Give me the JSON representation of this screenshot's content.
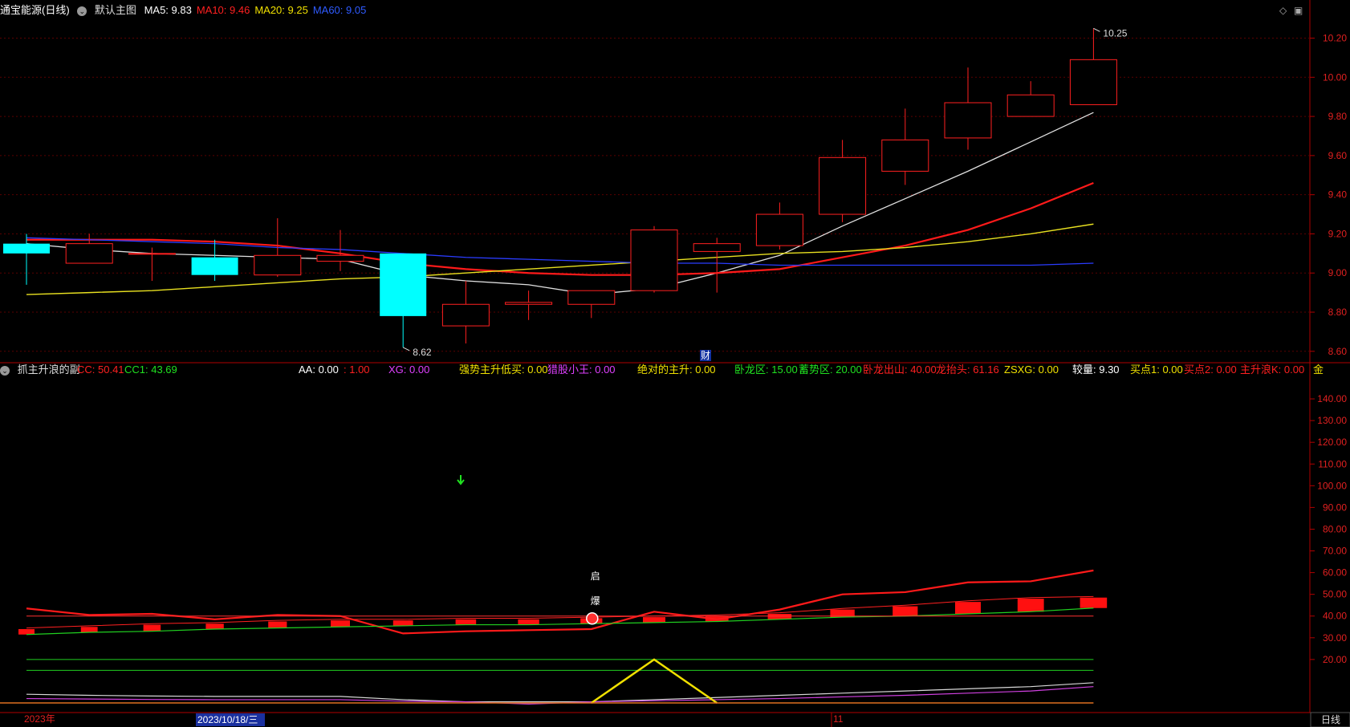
{
  "header": {
    "stock_title": "通宝能源(日线)",
    "template_name": "默认主图",
    "ma_items": [
      {
        "label": "MA5: 9.83",
        "color": "#ffffff"
      },
      {
        "label": "MA10: 9.46",
        "color": "#ff2020"
      },
      {
        "label": "MA20: 9.25",
        "color": "#f0e000"
      },
      {
        "label": "MA60: 9.05",
        "color": "#2f5bff"
      }
    ]
  },
  "indicator_header": {
    "name": "抓主升浪的副",
    "items": [
      {
        "label": "CC: 50.41",
        "color": "#ff2020"
      },
      {
        "label": "CC1: 43.69",
        "color": "#20e020"
      },
      {
        "label": "AA: 0.00",
        "color": "#ffffff"
      },
      {
        "label": ": 1.00",
        "color": "#ff2020"
      },
      {
        "label": "XG: 0.00",
        "color": "#e040ff"
      },
      {
        "label": "强势主升低买: 0.00",
        "color": "#f0e000"
      },
      {
        "label": "猎股小王: 0.00",
        "color": "#e040ff"
      },
      {
        "label": "绝对的主升: 0.00",
        "color": "#f0e000"
      },
      {
        "label": "卧龙区: 15.00",
        "color": "#20e020"
      },
      {
        "label": "蓄势区: 20.00",
        "color": "#20e020"
      },
      {
        "label": "卧龙出山: 40.00",
        "color": "#ff2020"
      },
      {
        "label": "龙抬头: 61.16",
        "color": "#ff2020"
      },
      {
        "label": "ZSXG: 0.00",
        "color": "#f0e000"
      },
      {
        "label": "较量: 9.30",
        "color": "#ffffff"
      },
      {
        "label": "买点1: 0.00",
        "color": "#f0e000"
      },
      {
        "label": "买点2: 0.00",
        "color": "#ff2020"
      },
      {
        "label": "主升浪K: 0.00",
        "color": "#ff2020"
      },
      {
        "label": "金",
        "color": "#f0e000"
      }
    ]
  },
  "markers": {
    "high_label": "10.25",
    "low_label": "8.62",
    "cai_label": "财",
    "qi_label": "启",
    "bao_label": "爆"
  },
  "time_axis": {
    "year_label": "2023年",
    "cursor_date": "2023/10/18/三",
    "month_label": "11",
    "period_label": "日线"
  },
  "colors": {
    "up": "#ff2020",
    "down": "#00ffff",
    "ma5": "#e0e0e0",
    "ma10": "#ff1a1a",
    "ma20": "#e8e020",
    "ma60": "#2a3cff",
    "axis": "#b00000",
    "grid": "#5a0000"
  },
  "chart_data": [
    {
      "type": "candlestick",
      "title": "通宝能源(日线)",
      "ylim": [
        8.55,
        10.28
      ],
      "y_ticks": [
        8.6,
        8.8,
        9.0,
        9.2,
        9.4,
        9.6,
        9.8,
        10.0,
        10.2
      ],
      "candles": [
        {
          "o": 9.15,
          "c": 9.1,
          "h": 9.2,
          "l": 8.94
        },
        {
          "o": 9.05,
          "c": 9.15,
          "h": 9.2,
          "l": 9.05
        },
        {
          "o": 9.1,
          "c": 9.1,
          "h": 9.13,
          "l": 8.96
        },
        {
          "o": 9.08,
          "c": 8.99,
          "h": 9.17,
          "l": 8.96
        },
        {
          "o": 8.99,
          "c": 9.09,
          "h": 9.28,
          "l": 8.98
        },
        {
          "o": 9.06,
          "c": 9.09,
          "h": 9.22,
          "l": 9.01
        },
        {
          "o": 9.1,
          "c": 8.78,
          "h": 9.1,
          "l": 8.62
        },
        {
          "o": 8.73,
          "c": 8.84,
          "h": 8.96,
          "l": 8.64
        },
        {
          "o": 8.84,
          "c": 8.85,
          "h": 8.91,
          "l": 8.76
        },
        {
          "o": 8.84,
          "c": 8.91,
          "h": 8.91,
          "l": 8.77
        },
        {
          "o": 8.91,
          "c": 9.22,
          "h": 9.24,
          "l": 8.9
        },
        {
          "o": 9.11,
          "c": 9.15,
          "h": 9.18,
          "l": 8.9
        },
        {
          "o": 9.14,
          "c": 9.3,
          "h": 9.36,
          "l": 9.12
        },
        {
          "o": 9.3,
          "c": 9.59,
          "h": 9.68,
          "l": 9.26
        },
        {
          "o": 9.52,
          "c": 9.68,
          "h": 9.84,
          "l": 9.45
        },
        {
          "o": 9.69,
          "c": 9.87,
          "h": 10.05,
          "l": 9.63
        },
        {
          "o": 9.8,
          "c": 9.91,
          "h": 9.98,
          "l": 9.8
        },
        {
          "o": 9.86,
          "c": 10.09,
          "h": 10.25,
          "l": 9.86
        }
      ],
      "series": [
        {
          "name": "MA5",
          "values": [
            9.15,
            9.12,
            9.1,
            9.09,
            9.08,
            9.07,
            8.99,
            8.96,
            8.94,
            8.89,
            8.92,
            9.0,
            9.09,
            9.24,
            9.38,
            9.52,
            9.67,
            9.82
          ]
        },
        {
          "name": "MA10",
          "values": [
            9.17,
            9.17,
            9.17,
            9.16,
            9.14,
            9.1,
            9.05,
            9.02,
            9.0,
            8.99,
            8.99,
            9.0,
            9.02,
            9.08,
            9.14,
            9.22,
            9.33,
            9.46
          ]
        },
        {
          "name": "MA20",
          "values": [
            8.89,
            8.9,
            8.91,
            8.93,
            8.95,
            8.97,
            8.98,
            9.0,
            9.02,
            9.04,
            9.06,
            9.08,
            9.1,
            9.11,
            9.13,
            9.16,
            9.2,
            9.25
          ]
        },
        {
          "name": "MA60",
          "values": [
            9.18,
            9.17,
            9.16,
            9.15,
            9.13,
            9.12,
            9.1,
            9.08,
            9.07,
            9.06,
            9.05,
            9.05,
            9.04,
            9.04,
            9.04,
            9.04,
            9.04,
            9.05
          ]
        }
      ]
    },
    {
      "type": "line",
      "title": "抓主升浪的副",
      "ylim": [
        0,
        150
      ],
      "y_ticks": [
        20,
        30,
        40,
        50,
        60,
        70,
        80,
        90,
        100,
        110,
        120,
        130,
        140
      ],
      "series": [
        {
          "name": "CC",
          "values": [
            43.5,
            40.5,
            41.0,
            38.5,
            40.5,
            40.0,
            32.0,
            33.0,
            33.5,
            34.0,
            42.0,
            38.5,
            43.0,
            50.0,
            51.0,
            55.5,
            56.0,
            61.0
          ]
        },
        {
          "name": "CC1",
          "values": [
            31.5,
            32.5,
            33.0,
            34.0,
            34.5,
            35.0,
            35.5,
            36.0,
            36.0,
            36.5,
            37.0,
            37.5,
            38.5,
            39.5,
            40.0,
            41.0,
            42.0,
            43.7
          ]
        },
        {
          "name": "卧龙区",
          "values": [
            15,
            15,
            15,
            15,
            15,
            15,
            15,
            15,
            15,
            15,
            15,
            15,
            15,
            15,
            15,
            15,
            15,
            15
          ]
        },
        {
          "name": "蓄势区",
          "values": [
            20,
            20,
            20,
            20,
            20,
            20,
            20,
            20,
            20,
            20,
            20,
            20,
            20,
            20,
            20,
            20,
            20,
            20
          ]
        },
        {
          "name": "卧龙出山",
          "values": [
            40,
            40,
            40,
            40,
            40,
            40,
            40,
            40,
            40,
            40,
            40,
            40,
            40,
            40,
            40,
            40,
            40,
            40
          ]
        },
        {
          "name": "较量",
          "values": [
            4.0,
            3.5,
            3.2,
            3.0,
            3.0,
            3.0,
            1.5,
            0.5,
            0.5,
            0.5,
            1.5,
            2.5,
            3.5,
            4.5,
            5.5,
            6.5,
            7.5,
            9.3
          ]
        },
        {
          "name": "XG",
          "values": [
            2.0,
            1.8,
            1.6,
            1.5,
            1.5,
            1.5,
            0.8,
            0.5,
            -0.5,
            0.5,
            1.0,
            1.5,
            2.0,
            2.8,
            3.5,
            4.5,
            5.5,
            7.5
          ]
        },
        {
          "name": "绝对的主升",
          "values": [
            0,
            0,
            0,
            0,
            0,
            0,
            0,
            0,
            0,
            0,
            20,
            0,
            0,
            0,
            0,
            0,
            0,
            0
          ]
        }
      ],
      "bars_between_cc1": [
        32.5,
        33.5,
        34.5,
        35.0,
        36.0,
        36.5,
        36.5,
        37.0,
        37.0,
        37.5,
        38.0,
        38.5,
        39.5,
        41.5,
        43.0,
        45.0,
        46.5,
        47.0
      ]
    }
  ]
}
